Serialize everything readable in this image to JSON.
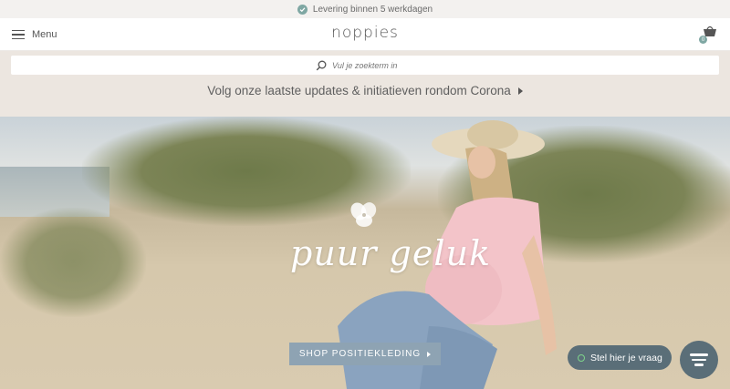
{
  "topbar": {
    "delivery_text": "Levering binnen 5 werkdagen"
  },
  "header": {
    "menu_label": "Menu",
    "logo_text": "noppies",
    "cart_count": "0"
  },
  "search": {
    "placeholder": "Vul je zoekterm in"
  },
  "announcement": {
    "text": "Volg onze laatste updates & initiatieven rondom Corona"
  },
  "hero": {
    "headline": "puur geluk",
    "cta_label": "SHOP POSITIEKLEDING"
  },
  "chat": {
    "prompt_label": "Stel hier je vraag"
  },
  "colors": {
    "accent": "#7fa7a3",
    "cta": "#8ea3b3",
    "chat": "#5a6e78",
    "band": "#ece6e0"
  }
}
